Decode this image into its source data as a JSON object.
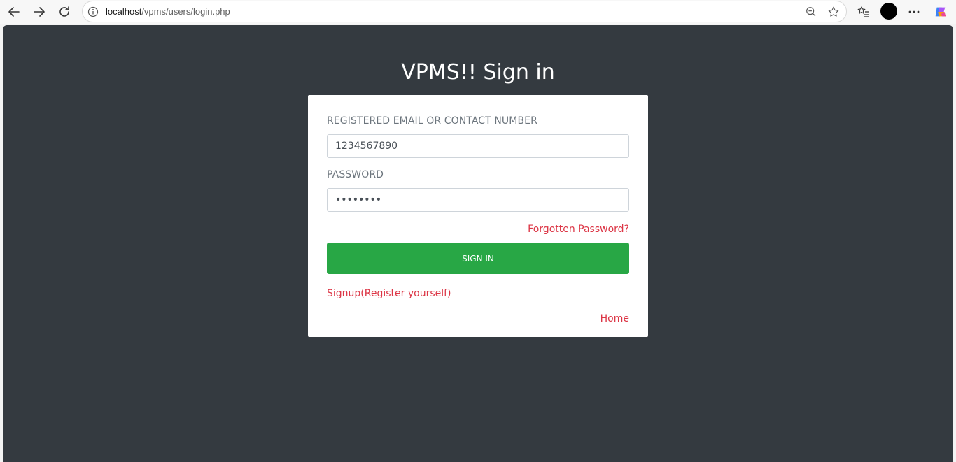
{
  "browser": {
    "url_host": "localhost",
    "url_path": "/vpms/users/login.php"
  },
  "page": {
    "title": "VPMS!! Sign in"
  },
  "form": {
    "email_label": "REGISTERED EMAIL OR CONTACT NUMBER",
    "email_value": "1234567890",
    "password_label": "PASSWORD",
    "password_value": "••••••••",
    "forgot_link": "Forgotten Password?",
    "signin_label": "SIGN IN",
    "signup_link": "Signup(Register yourself)",
    "home_link": "Home"
  },
  "colors": {
    "page_background": "#343a40",
    "button_green": "#28a745",
    "link_red": "#dc3545"
  },
  "icons": [
    "back-arrow-icon",
    "forward-arrow-icon",
    "reload-icon",
    "info-icon",
    "zoom-out-icon",
    "favorite-star-icon",
    "favorites-list-icon",
    "profile-avatar",
    "more-options-icon",
    "copilot-icon"
  ]
}
